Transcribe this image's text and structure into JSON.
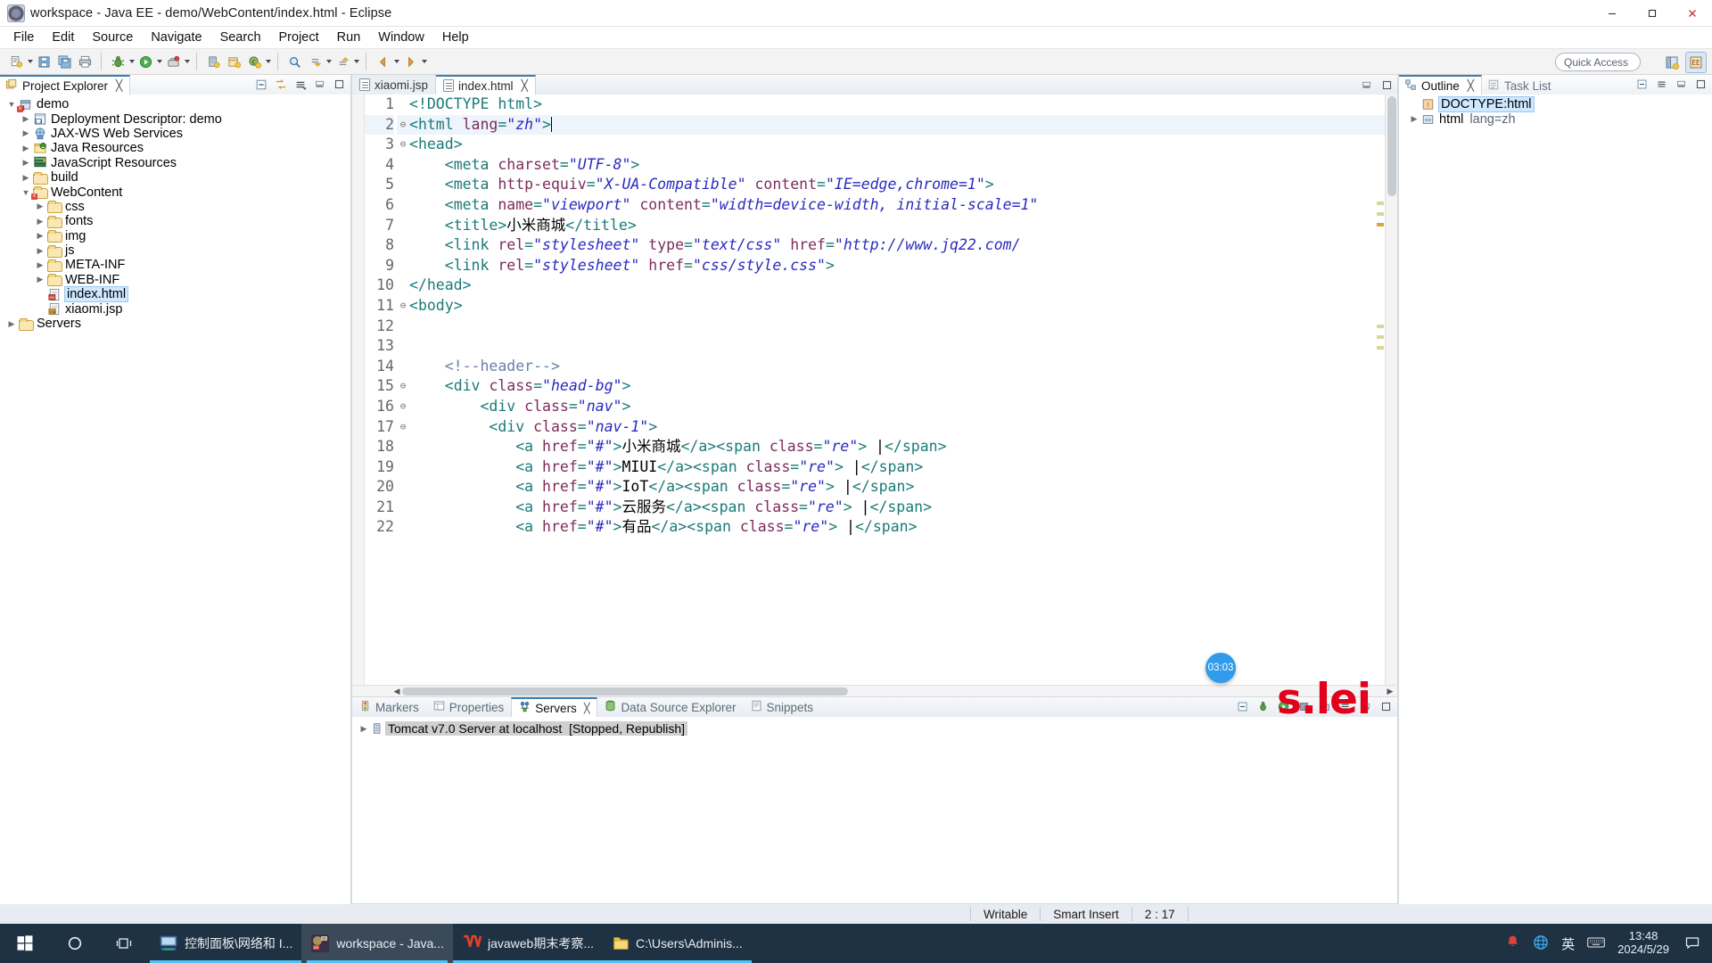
{
  "window": {
    "title": "workspace - Java EE - demo/WebContent/index.html - Eclipse",
    "minimize_label": "Minimize",
    "maximize_label": "Maximize",
    "close_label": "Close"
  },
  "menubar": [
    "File",
    "Edit",
    "Source",
    "Navigate",
    "Search",
    "Project",
    "Run",
    "Window",
    "Help"
  ],
  "toolbar": {
    "quick_access_placeholder": "Quick Access",
    "icons": [
      "new-icon",
      "save-icon",
      "save-all-icon",
      "print-icon",
      "debug-icon",
      "run-icon",
      "external-tools-icon",
      "new-server-icon",
      "new-java-project-icon",
      "new-class-icon",
      "search-icon",
      "next-annotation-icon",
      "previous-annotation-icon",
      "back-icon",
      "forward-icon"
    ],
    "perspective_buttons": [
      "open-perspective-icon",
      "java-ee-perspective-icon"
    ]
  },
  "explorer": {
    "tab_label": "Project Explorer",
    "close_glyph": "╳",
    "tools": [
      "collapse-all-icon",
      "link-with-editor-icon",
      "view-menu-icon",
      "minimize-icon",
      "maximize-icon"
    ],
    "tree": [
      {
        "label": "demo",
        "indent": 0,
        "arrow": "down",
        "icon": "project-icon"
      },
      {
        "label": "Deployment Descriptor: demo",
        "indent": 1,
        "arrow": "right",
        "icon": "deployment-descriptor-icon"
      },
      {
        "label": "JAX-WS Web Services",
        "indent": 1,
        "arrow": "right",
        "icon": "jaxws-icon"
      },
      {
        "label": "Java Resources",
        "indent": 1,
        "arrow": "right",
        "icon": "java-resources-icon"
      },
      {
        "label": "JavaScript Resources",
        "indent": 1,
        "arrow": "right",
        "icon": "javascript-resources-icon"
      },
      {
        "label": "build",
        "indent": 1,
        "arrow": "right",
        "icon": "folder-icon"
      },
      {
        "label": "WebContent",
        "indent": 1,
        "arrow": "down",
        "icon": "folder-icon"
      },
      {
        "label": "css",
        "indent": 2,
        "arrow": "right",
        "icon": "folder-icon"
      },
      {
        "label": "fonts",
        "indent": 2,
        "arrow": "right",
        "icon": "folder-icon"
      },
      {
        "label": "img",
        "indent": 2,
        "arrow": "right",
        "icon": "folder-icon"
      },
      {
        "label": "js",
        "indent": 2,
        "arrow": "right",
        "icon": "folder-icon"
      },
      {
        "label": "META-INF",
        "indent": 2,
        "arrow": "right",
        "icon": "folder-icon"
      },
      {
        "label": "WEB-INF",
        "indent": 2,
        "arrow": "right",
        "icon": "folder-icon"
      },
      {
        "label": "index.html",
        "indent": 2,
        "arrow": "none",
        "icon": "html-file-icon",
        "selected": true
      },
      {
        "label": "xiaomi.jsp",
        "indent": 2,
        "arrow": "none",
        "icon": "jsp-file-icon"
      },
      {
        "label": "Servers",
        "indent": 0,
        "arrow": "right",
        "icon": "folder-icon"
      }
    ]
  },
  "editor": {
    "tabs": [
      {
        "label": "xiaomi.jsp",
        "active": false
      },
      {
        "label": "index.html",
        "active": true,
        "close_glyph": "╳"
      }
    ],
    "lines": [
      {
        "n": "1",
        "fold": "",
        "html": "<span class=\"punc\">&lt;!</span><span class=\"tag\">DOCTYPE html</span><span class=\"punc\">&gt;</span>"
      },
      {
        "n": "2",
        "fold": "⊖",
        "hl": true,
        "html": "<span class=\"punc\">&lt;</span><span class=\"tag\">html </span><span class=\"attr\">lang</span><span class=\"punc\">=</span><span class=\"val\">\"zh\"</span><span class=\"punc\">&gt;</span><span class=\"caretbar\"></span>"
      },
      {
        "n": "3",
        "fold": "⊖",
        "html": "<span class=\"punc\">&lt;</span><span class=\"tag\">head</span><span class=\"punc\">&gt;</span>"
      },
      {
        "n": "4",
        "fold": "",
        "html": "    <span class=\"punc\">&lt;</span><span class=\"tag\">meta </span><span class=\"attr\">charset</span><span class=\"punc\">=</span><span class=\"val\">\"UTF-8\"</span><span class=\"punc\">&gt;</span>"
      },
      {
        "n": "5",
        "fold": "",
        "html": "    <span class=\"punc\">&lt;</span><span class=\"tag\">meta </span><span class=\"attr\">http-equiv</span><span class=\"punc\">=</span><span class=\"val\">\"X-UA-Compatible\"</span> <span class=\"attr\">content</span><span class=\"punc\">=</span><span class=\"val\">\"IE=edge,chrome=1\"</span><span class=\"punc\">&gt;</span>"
      },
      {
        "n": "6",
        "fold": "",
        "html": "    <span class=\"punc\">&lt;</span><span class=\"tag\">meta </span><span class=\"attr\">name</span><span class=\"punc\">=</span><span class=\"val\">\"viewport\"</span> <span class=\"attr\">content</span><span class=\"punc\">=</span><span class=\"val\">\"width=device-width, initial-scale=1\"</span>"
      },
      {
        "n": "7",
        "fold": "",
        "html": "    <span class=\"punc\">&lt;</span><span class=\"tag\">title</span><span class=\"punc\">&gt;</span><span class=\"txt\">小米商城</span><span class=\"punc\">&lt;/</span><span class=\"tag\">title</span><span class=\"punc\">&gt;</span>"
      },
      {
        "n": "8",
        "fold": "",
        "html": "    <span class=\"punc\">&lt;</span><span class=\"tag\">link </span><span class=\"attr\">rel</span><span class=\"punc\">=</span><span class=\"val\">\"stylesheet\"</span> <span class=\"attr\">type</span><span class=\"punc\">=</span><span class=\"val\">\"text/css\"</span> <span class=\"attr\">href</span><span class=\"punc\">=</span><span class=\"val\">\"http://www.jq22.com/</span>"
      },
      {
        "n": "9",
        "fold": "",
        "html": "    <span class=\"punc\">&lt;</span><span class=\"tag\">link </span><span class=\"attr\">rel</span><span class=\"punc\">=</span><span class=\"val\">\"stylesheet\"</span> <span class=\"attr\">href</span><span class=\"punc\">=</span><span class=\"val\">\"css/style.css\"</span><span class=\"punc\">&gt;</span>"
      },
      {
        "n": "10",
        "fold": "",
        "html": "<span class=\"punc\">&lt;/</span><span class=\"tag\">head</span><span class=\"punc\">&gt;</span>"
      },
      {
        "n": "11",
        "fold": "⊖",
        "html": "<span class=\"punc\">&lt;</span><span class=\"tag\">body</span><span class=\"punc\">&gt;</span>"
      },
      {
        "n": "12",
        "fold": "",
        "html": ""
      },
      {
        "n": "13",
        "fold": "",
        "html": ""
      },
      {
        "n": "14",
        "fold": "",
        "html": "    <span class=\"cmt\">&lt;!--header--&gt;</span>"
      },
      {
        "n": "15",
        "fold": "⊖",
        "html": "    <span class=\"punc\">&lt;</span><span class=\"tag\">div </span><span class=\"attr\">class</span><span class=\"punc\">=</span><span class=\"val\">\"head-bg\"</span><span class=\"punc\">&gt;</span>"
      },
      {
        "n": "16",
        "fold": "⊖",
        "html": "        <span class=\"punc\">&lt;</span><span class=\"tag\">div </span><span class=\"attr\">class</span><span class=\"punc\">=</span><span class=\"val\">\"nav\"</span><span class=\"punc\">&gt;</span>"
      },
      {
        "n": "17",
        "fold": "⊖",
        "html": "         <span class=\"punc\">&lt;</span><span class=\"tag\">div </span><span class=\"attr\">class</span><span class=\"punc\">=</span><span class=\"val\">\"nav-1\"</span><span class=\"punc\">&gt;</span>"
      },
      {
        "n": "18",
        "fold": "",
        "html": "            <span class=\"punc\">&lt;</span><span class=\"tag\">a </span><span class=\"attr\">href</span><span class=\"punc\">=</span><span class=\"val\">\"#\"</span><span class=\"punc\">&gt;</span><span class=\"txt\">小米商城</span><span class=\"punc\">&lt;/</span><span class=\"tag\">a</span><span class=\"punc\">&gt;&lt;</span><span class=\"tag\">span </span><span class=\"attr\">class</span><span class=\"punc\">=</span><span class=\"val\">\"re\"</span><span class=\"punc\">&gt;</span><span class=\"txt\"> |</span><span class=\"punc\">&lt;/</span><span class=\"tag\">span</span><span class=\"punc\">&gt;</span>"
      },
      {
        "n": "19",
        "fold": "",
        "html": "            <span class=\"punc\">&lt;</span><span class=\"tag\">a </span><span class=\"attr\">href</span><span class=\"punc\">=</span><span class=\"val\">\"#\"</span><span class=\"punc\">&gt;</span><span class=\"txt\">MIUI</span><span class=\"punc\">&lt;/</span><span class=\"tag\">a</span><span class=\"punc\">&gt;&lt;</span><span class=\"tag\">span </span><span class=\"attr\">class</span><span class=\"punc\">=</span><span class=\"val\">\"re\"</span><span class=\"punc\">&gt;</span><span class=\"txt\"> |</span><span class=\"punc\">&lt;/</span><span class=\"tag\">span</span><span class=\"punc\">&gt;</span>"
      },
      {
        "n": "20",
        "fold": "",
        "html": "            <span class=\"punc\">&lt;</span><span class=\"tag\">a </span><span class=\"attr\">href</span><span class=\"punc\">=</span><span class=\"val\">\"#\"</span><span class=\"punc\">&gt;</span><span class=\"txt\">IoT</span><span class=\"punc\">&lt;/</span><span class=\"tag\">a</span><span class=\"punc\">&gt;&lt;</span><span class=\"tag\">span </span><span class=\"attr\">class</span><span class=\"punc\">=</span><span class=\"val\">\"re\"</span><span class=\"punc\">&gt;</span><span class=\"txt\"> |</span><span class=\"punc\">&lt;/</span><span class=\"tag\">span</span><span class=\"punc\">&gt;</span>"
      },
      {
        "n": "21",
        "fold": "",
        "html": "            <span class=\"punc\">&lt;</span><span class=\"tag\">a </span><span class=\"attr\">href</span><span class=\"punc\">=</span><span class=\"val\">\"#\"</span><span class=\"punc\">&gt;</span><span class=\"txt\">云服务</span><span class=\"punc\">&lt;/</span><span class=\"tag\">a</span><span class=\"punc\">&gt;&lt;</span><span class=\"tag\">span </span><span class=\"attr\">class</span><span class=\"punc\">=</span><span class=\"val\">\"re\"</span><span class=\"punc\">&gt;</span><span class=\"txt\"> |</span><span class=\"punc\">&lt;/</span><span class=\"tag\">span</span><span class=\"punc\">&gt;</span>"
      },
      {
        "n": "22",
        "fold": "",
        "html": "            <span class=\"punc\">&lt;</span><span class=\"tag\">a </span><span class=\"attr\">href</span><span class=\"punc\">=</span><span class=\"val\">\"#\"</span><span class=\"punc\">&gt;</span><span class=\"txt\">有品</span><span class=\"punc\">&lt;/</span><span class=\"tag\">a</span><span class=\"punc\">&gt;&lt;</span><span class=\"tag\">span </span><span class=\"attr\">class</span><span class=\"punc\">=</span><span class=\"val\">\"re\"</span><span class=\"punc\">&gt;</span><span class=\"txt\"> |</span><span class=\"punc\">&lt;/</span><span class=\"tag\">span</span><span class=\"punc\">&gt;</span>"
      }
    ]
  },
  "outline": {
    "tab_label": "Outline",
    "close_glyph": "╳",
    "task_list_label": "Task List",
    "items": [
      {
        "label": "DOCTYPE:html",
        "selected": true,
        "arrow": "none",
        "icon": "doctype-icon"
      },
      {
        "label": "html",
        "suffix": "lang=zh",
        "selected": false,
        "arrow": "right",
        "icon": "element-icon"
      }
    ]
  },
  "bottom_panel": {
    "tabs": [
      {
        "label": "Markers",
        "icon": "markers-icon",
        "active": false
      },
      {
        "label": "Properties",
        "icon": "properties-icon",
        "active": false
      },
      {
        "label": "Servers",
        "icon": "servers-icon",
        "active": true,
        "close_glyph": "╳"
      },
      {
        "label": "Data Source Explorer",
        "icon": "data-source-icon",
        "active": false
      },
      {
        "label": "Snippets",
        "icon": "snippets-icon",
        "active": false
      }
    ],
    "server_row": {
      "name": "Tomcat v7.0 Server at localhost",
      "state": "[Stopped, Republish]",
      "arrow": "right",
      "icon": "server-icon"
    },
    "tools": [
      "collapse-all-icon",
      "debug-server-icon",
      "start-server-icon",
      "stop-server-icon",
      "publish-icon",
      "view-menu-icon",
      "minimize-icon",
      "maximize-icon"
    ]
  },
  "statusbar": {
    "writable": "Writable",
    "insert_mode": "Smart Insert",
    "position": "2 : 17"
  },
  "overlays": {
    "timer": "03:03",
    "watermark": "s.lei"
  },
  "taskbar": {
    "start_icon": "windows-start-icon",
    "search_icon": "cortana-search-icon",
    "taskview_icon": "task-view-icon",
    "items": [
      {
        "label": "控制面板\\网络和 I...",
        "icon": "network-icon",
        "active": false,
        "running": true
      },
      {
        "label": "workspace - Java...",
        "icon": "eclipse-icon",
        "active": true,
        "running": true
      },
      {
        "label": "javaweb期末考察...",
        "icon": "wps-icon",
        "active": false,
        "running": true
      },
      {
        "label": "C:\\Users\\Adminis...",
        "icon": "folder-icon",
        "active": false,
        "running": true
      }
    ],
    "tray": [
      "notification-red-icon",
      "network-globe-icon"
    ],
    "ime": "英",
    "ime_keyboard": "keyboard-icon",
    "clock_time": "13:48",
    "clock_date": "2024/5/29",
    "action_center_icon": "action-center-icon"
  }
}
